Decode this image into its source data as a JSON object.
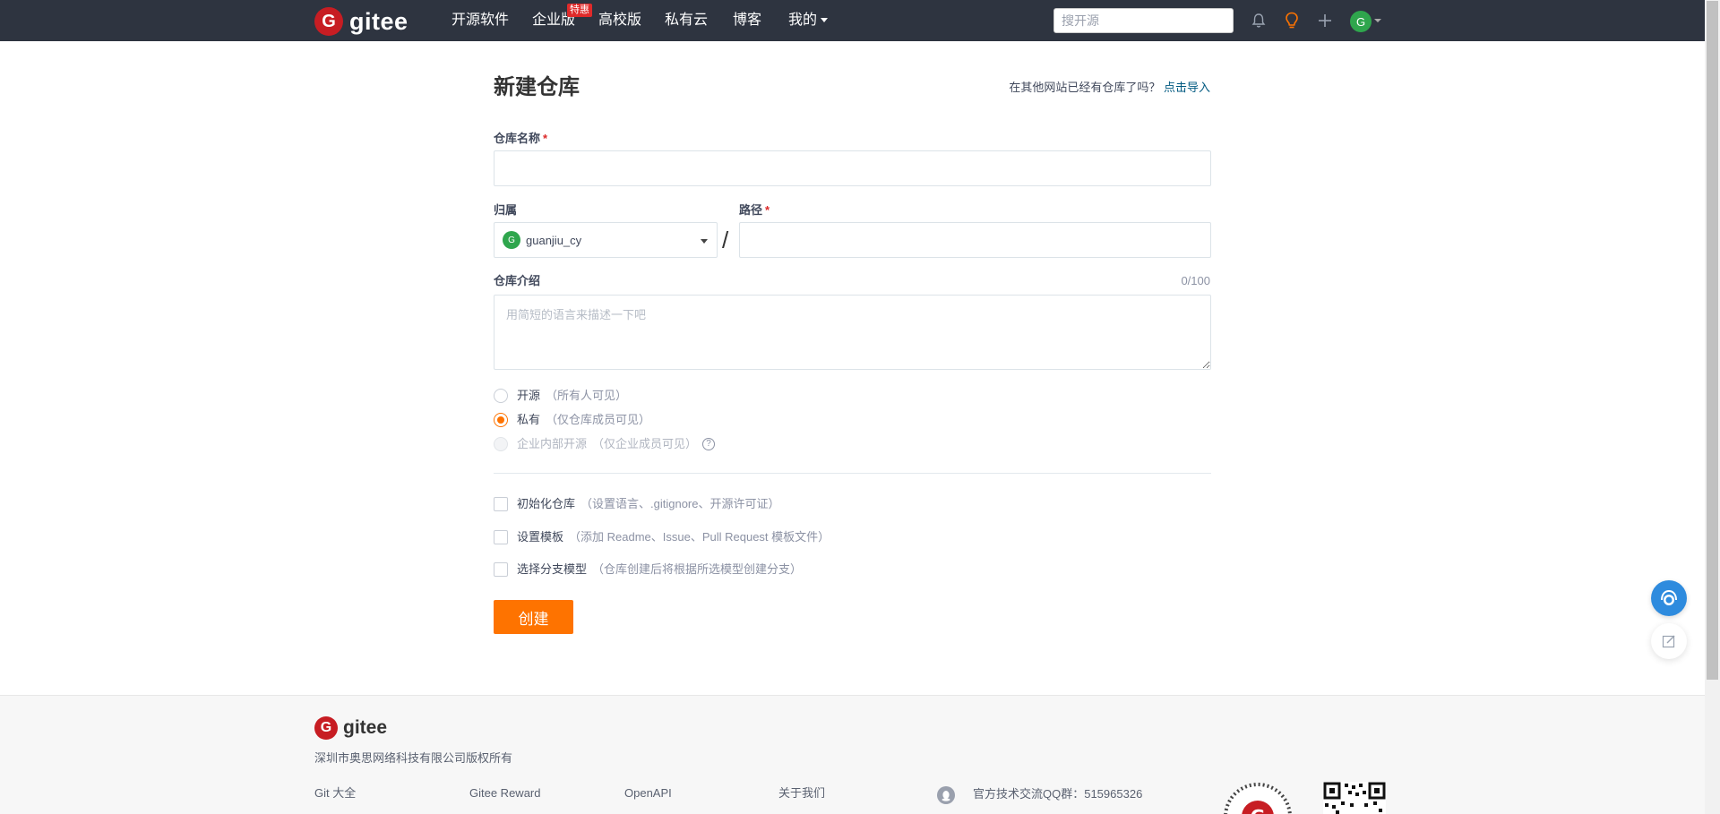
{
  "topbar": {
    "logo_text": "gitee",
    "nav": [
      "开源软件",
      "企业版",
      "高校版",
      "私有云",
      "博客",
      "我的"
    ],
    "enterprise_badge": "特惠",
    "search_placeholder": "搜开源",
    "avatar_letter": "G",
    "icons": [
      "bell-icon",
      "lightbulb-icon",
      "plus-icon"
    ]
  },
  "form": {
    "title": "新建仓库",
    "import_hint": "在其他网站已经有仓库了吗？",
    "import_link": "点击导入",
    "repo_name_label": "仓库名称",
    "required_mark": "*",
    "owner_label": "归属",
    "owner_avatar_letter": "G",
    "owner_value": "guanjiu_cy",
    "path_label": "路径",
    "path_separator": "/",
    "description_label": "仓库介绍",
    "description_count": "0/100",
    "description_placeholder": "用简短的语言来描述一下吧",
    "visibility": [
      {
        "label": "开源",
        "desc": "（所有人可见）",
        "checked": false,
        "disabled": false
      },
      {
        "label": "私有",
        "desc": "（仅仓库成员可见）",
        "checked": true,
        "disabled": false
      },
      {
        "label": "企业内部开源",
        "desc": "（仅企业成员可见）",
        "checked": false,
        "disabled": true
      }
    ],
    "options": [
      {
        "label": "初始化仓库",
        "desc": "（设置语言、.gitignore、开源许可证）"
      },
      {
        "label": "设置模板",
        "desc": "（添加 Readme、Issue、Pull Request 模板文件）"
      },
      {
        "label": "选择分支模型",
        "desc": "（仓库创建后将根据所选模型创建分支）"
      }
    ],
    "submit_label": "创建"
  },
  "footer": {
    "logo_text": "gitee",
    "copyright": "深圳市奥思网络科技有限公司版权所有",
    "links": [
      "Git 大全",
      "Gitee Reward",
      "OpenAPI",
      "关于我们"
    ],
    "qq_group": "官方技术交流QQ群：515965326"
  },
  "colors": {
    "topbar_bg": "#2e3440",
    "brand_red": "#c71d23",
    "accent_orange": "#fe7300",
    "link_blue": "#005980"
  }
}
